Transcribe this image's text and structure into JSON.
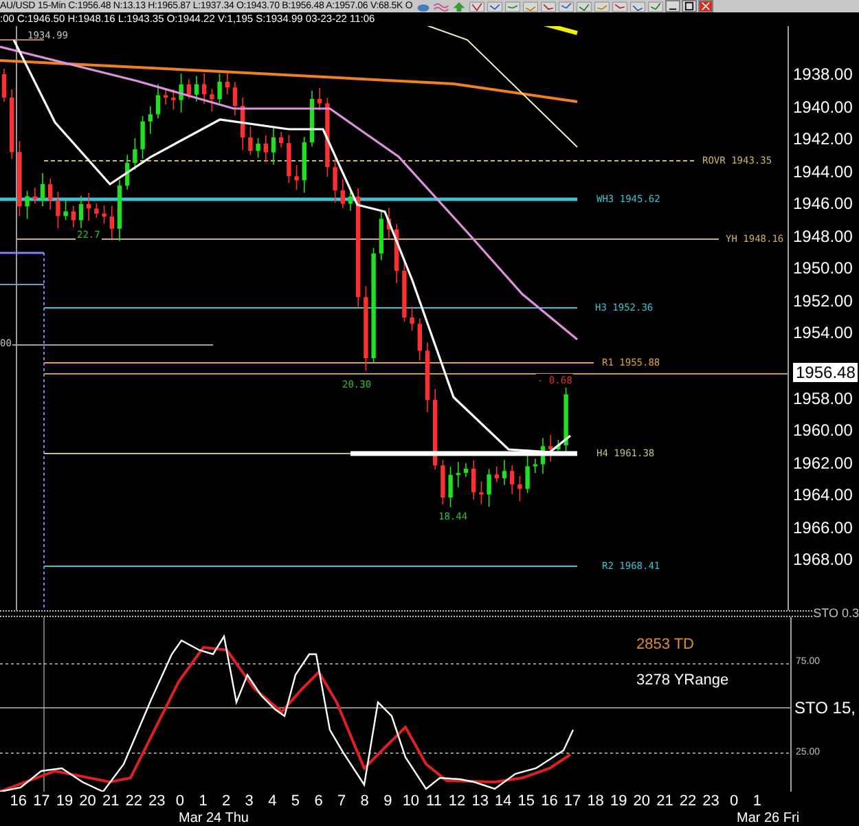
{
  "header": {
    "quote": "AU/USD 15-Min C:1956.48 N:13.13 H:1965.87 L:1937.34 O:1943.70 B:1956.48 A:1957.06 V:68.5K O",
    "bar_info": ":00 C:1946.50 H:1948.16 L:1943.35 O:1944.22 V:1,195 S:1934.99 03-23-22 11:06"
  },
  "chart": {
    "top_label": "1934.99",
    "edge_label": "00",
    "current_price": "1956.48",
    "axis_labels": [
      "1938.00",
      "1940.00",
      "1942.00",
      "1944.00",
      "1946.00",
      "1948.00",
      "1950.00",
      "1952.00",
      "1954.00",
      "1958.00",
      "1960.00",
      "1962.00",
      "1964.00",
      "1966.00",
      "1968.00"
    ],
    "levels": [
      {
        "label": "ROVR 1943.35",
        "color": "#c8b860"
      },
      {
        "label": "WH3 1945.62",
        "color": "#40c0d0"
      },
      {
        "label": "YH 1948.16",
        "color": "#d0b060"
      },
      {
        "label": "H3 1952.36",
        "color": "#40c0d0"
      },
      {
        "label": "R1 1955.88",
        "color": "#e0a040"
      },
      {
        "label": "H4 1961.38",
        "color": "#c0c080"
      },
      {
        "label": "R2 1968.41",
        "color": "#40c0d0"
      }
    ],
    "swing_labels": [
      {
        "label": "22.7",
        "color": "#30c030"
      },
      {
        "label": "20.30",
        "color": "#30c030"
      },
      {
        "label": "18.44",
        "color": "#30c030"
      },
      {
        "label": "- 0.68",
        "color": "#e03030"
      }
    ]
  },
  "indicator": {
    "top_title": "STO 0.3",
    "title": "STO 15,",
    "axis_labels": [
      "75.00",
      "25.00"
    ],
    "notes": [
      {
        "label": "2853 TD",
        "color": "#e08a3c"
      },
      {
        "label": "3278 YRange",
        "color": "#ffffff"
      }
    ]
  },
  "time_axis": {
    "hours": [
      "16",
      "17",
      "19",
      "20",
      "21",
      "22",
      "23",
      "0",
      "1",
      "2",
      "3",
      "4",
      "5",
      "6",
      "7",
      "8",
      "9",
      "10",
      "11",
      "12",
      "13",
      "14",
      "15",
      "16",
      "17",
      "18",
      "19",
      "20",
      "21",
      "22",
      "23",
      "0",
      "1"
    ],
    "dates": [
      "Mar 24 Thu",
      "Mar 26 Fri"
    ]
  }
}
